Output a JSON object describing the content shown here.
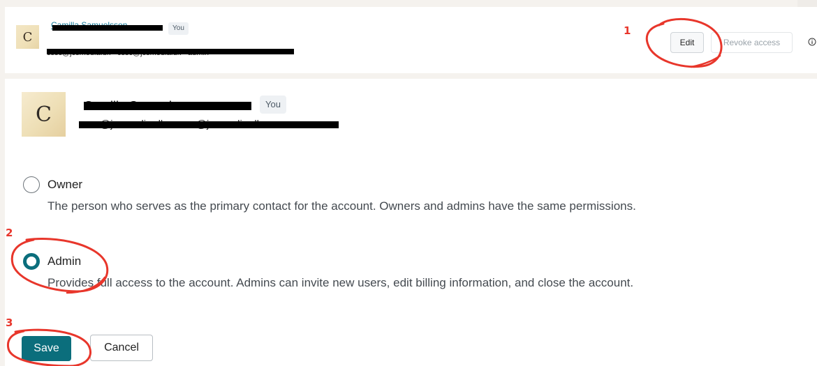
{
  "top_row": {
    "avatar_letter": "C",
    "name": "Camilla Samuelsson",
    "badge": "You",
    "email": "cssc@jcsmedia.dk · cssc@jcsmedia.dk · admin",
    "edit_label": "Edit",
    "revoke_label": "Revoke access"
  },
  "main_card": {
    "avatar_letter": "C",
    "name": "Camilla Samuelsson",
    "badge": "You",
    "email": "cssc@jcsmedia.dk · cssc@jcsmedia.dk",
    "roles": [
      {
        "label": "Owner",
        "description": "The person who serves as the primary contact for the account. Owners and admins have the same permissions.",
        "selected": false
      },
      {
        "label": "Admin",
        "description": "Provides full access to the account. Admins can invite new users, edit billing information, and close the account.",
        "selected": true
      }
    ],
    "save_label": "Save",
    "cancel_label": "Cancel"
  },
  "annotations": {
    "steps": [
      "1",
      "2",
      "3"
    ],
    "color": "#e8362b"
  },
  "colors": {
    "accent": "#0b6e7c",
    "link": "#137a9a"
  },
  "icons": {
    "info": "info-icon"
  }
}
